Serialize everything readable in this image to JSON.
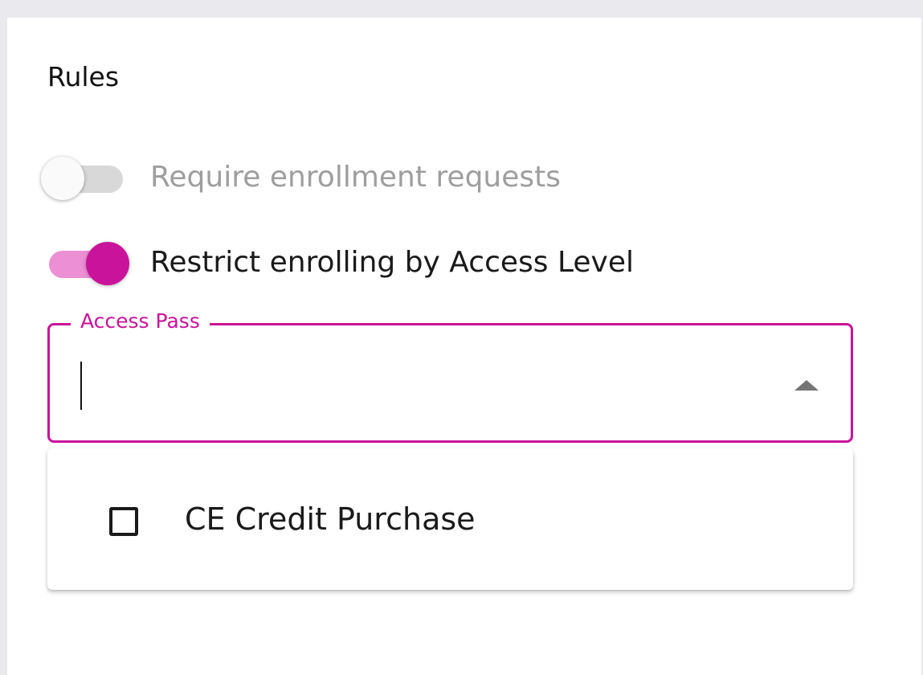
{
  "rules": {
    "title": "Rules",
    "require_enrollment": {
      "label": "Require enrollment requests",
      "enabled": false,
      "disabled": true
    },
    "restrict_access_level": {
      "label": "Restrict enrolling by Access Level",
      "enabled": true
    },
    "access_pass": {
      "label": "Access Pass",
      "value": "",
      "placeholder": "",
      "menu_open": true,
      "options": [
        {
          "label": "CE Credit Purchase",
          "checked": false
        }
      ]
    }
  },
  "colors": {
    "accent": "#c9139b",
    "accent_track": "#ec8fd4",
    "disabled_text": "#9e9e9e",
    "page_background": "#e9e9ee"
  },
  "icons": {
    "dropdown": "arrow-drop-up-icon",
    "checkbox": "checkbox-unchecked-icon"
  }
}
